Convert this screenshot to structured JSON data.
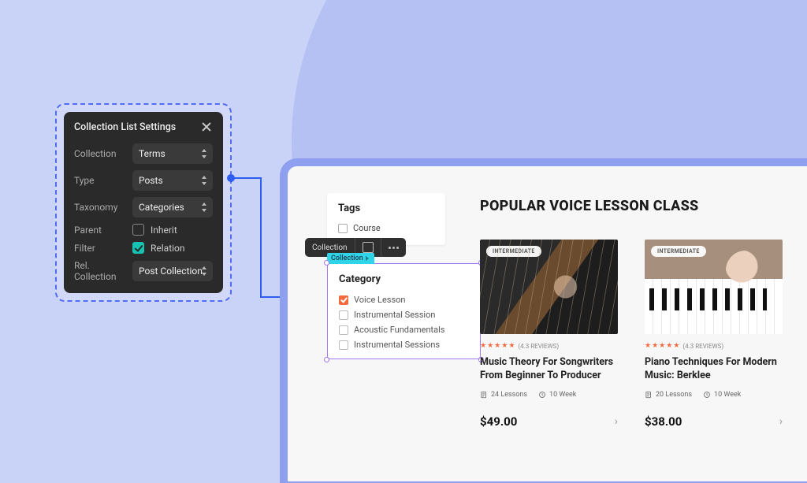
{
  "settings": {
    "title": "Collection List Settings",
    "rows": {
      "collection": {
        "label": "Collection",
        "value": "Terms"
      },
      "type": {
        "label": "Type",
        "value": "Posts"
      },
      "taxonomy": {
        "label": "Taxonomy",
        "value": "Categories"
      },
      "parent": {
        "label": "Parent",
        "check_label": "Inherit",
        "checked": false
      },
      "filter": {
        "label": "Filter",
        "check_label": "Relation",
        "checked": true
      },
      "rel": {
        "label": "Rel. Collection",
        "value": "Post Collection"
      }
    }
  },
  "toolbar": {
    "chip": "Collection"
  },
  "tags": {
    "title": "Tags",
    "items": [
      "Course"
    ]
  },
  "category": {
    "badge": "Collection",
    "title": "Category",
    "items": [
      {
        "label": "Voice Lesson",
        "checked": true
      },
      {
        "label": "Instrumental Session",
        "checked": false
      },
      {
        "label": "Acoustic Fundamentals",
        "checked": false
      },
      {
        "label": "Instrumental Sessions",
        "checked": false
      }
    ]
  },
  "section": {
    "title": "POPULAR VOICE LESSON CLASS"
  },
  "cards": [
    {
      "level": "INTERMEDIATE",
      "rating_text": "(4.3 REVIEWS)",
      "title": "Music Theory For Songwriters From Beginner To Producer",
      "lessons": "24 Lessons",
      "weeks": "10 Week",
      "price": "$49.00"
    },
    {
      "level": "INTERMEDIATE",
      "rating_text": "(4.3 REVIEWS)",
      "title": "Piano Techniques For Modern Music: Berklee",
      "lessons": "20 Lessons",
      "weeks": "10 Week",
      "price": "$38.00"
    }
  ]
}
